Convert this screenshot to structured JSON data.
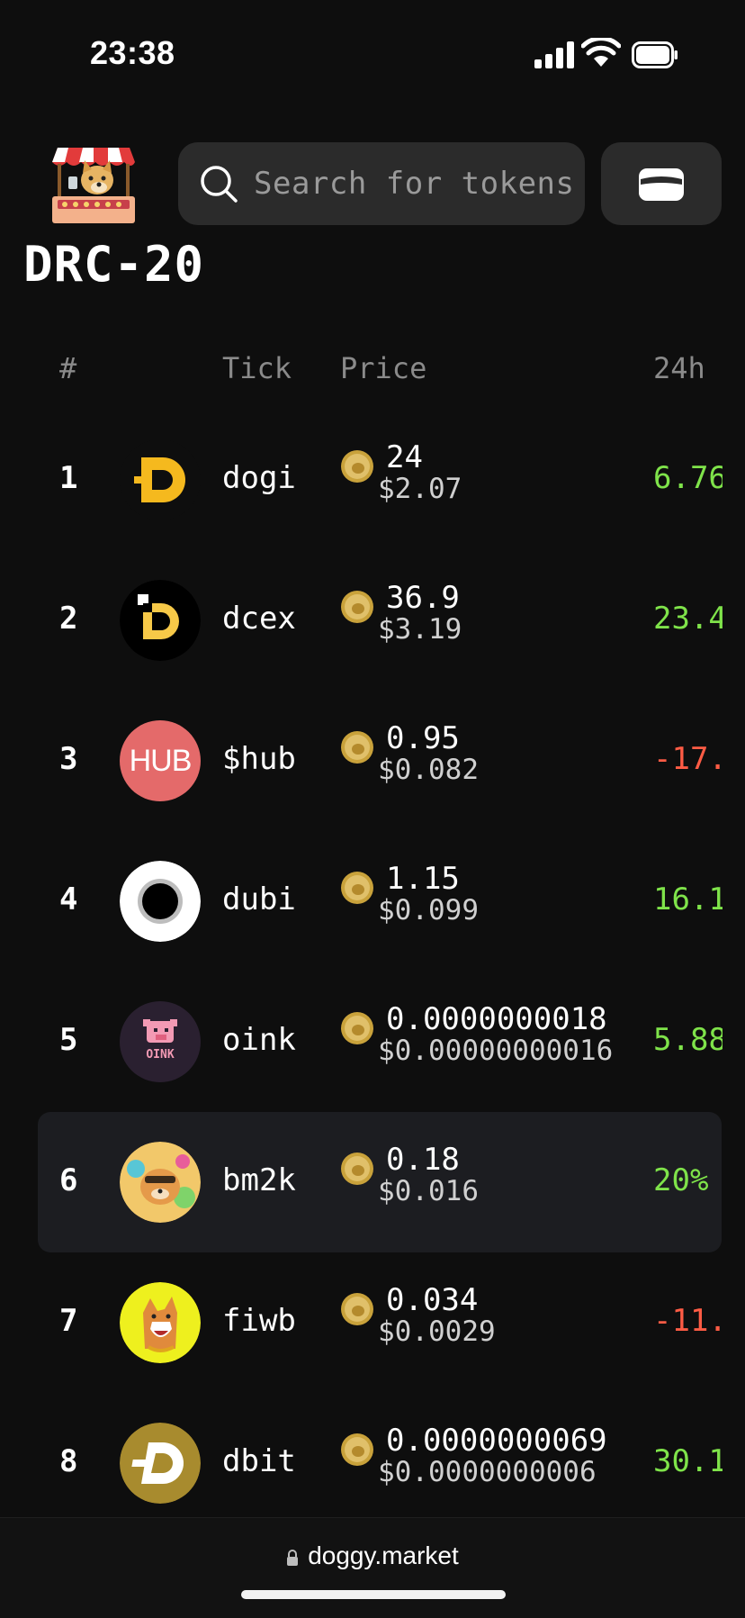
{
  "status": {
    "time": "23:38"
  },
  "search": {
    "placeholder": "Search for tokens"
  },
  "page": {
    "title": "DRC-20"
  },
  "columns": {
    "rank": "#",
    "tick": "Tick",
    "price": "Price",
    "change": "24h"
  },
  "colors": {
    "positive": "#7fe34a",
    "negative": "#ff5c45",
    "highlight": "#1c1d21"
  },
  "tokens": [
    {
      "rank": "1",
      "tick": "dogi",
      "price": "24",
      "usd": "$2.07",
      "change": "6.76",
      "trend": "up",
      "icon": "dogi-logo-icon"
    },
    {
      "rank": "2",
      "tick": "dcex",
      "price": "36.9",
      "usd": "$3.19",
      "change": "23.4",
      "trend": "up",
      "icon": "dcex-logo-icon"
    },
    {
      "rank": "3",
      "tick": "$hub",
      "price": "0.95",
      "usd": "$0.082",
      "change": "-17.",
      "trend": "down",
      "icon": "hub-logo-icon",
      "icon_text": "HUB"
    },
    {
      "rank": "4",
      "tick": "dubi",
      "price": "1.15",
      "usd": "$0.099",
      "change": "16.1",
      "trend": "up",
      "icon": "dubi-logo-icon"
    },
    {
      "rank": "5",
      "tick": "oink",
      "price": "0.0000000018",
      "usd": "$0.00000000016",
      "change": "5.88",
      "trend": "up",
      "icon": "oink-logo-icon",
      "icon_text": "OINK"
    },
    {
      "rank": "6",
      "tick": "bm2k",
      "price": "0.18",
      "usd": "$0.016",
      "change": "20%",
      "trend": "up",
      "icon": "bm2k-logo-icon",
      "selected": true
    },
    {
      "rank": "7",
      "tick": "fiwb",
      "price": "0.034",
      "usd": "$0.0029",
      "change": "-11.",
      "trend": "down",
      "icon": "fiwb-logo-icon"
    },
    {
      "rank": "8",
      "tick": "dbit",
      "price": "0.0000000069",
      "usd": "$0.0000000006",
      "change": "30.1",
      "trend": "up",
      "icon": "dbit-logo-icon"
    }
  ],
  "browser": {
    "url": "doggy.market"
  }
}
